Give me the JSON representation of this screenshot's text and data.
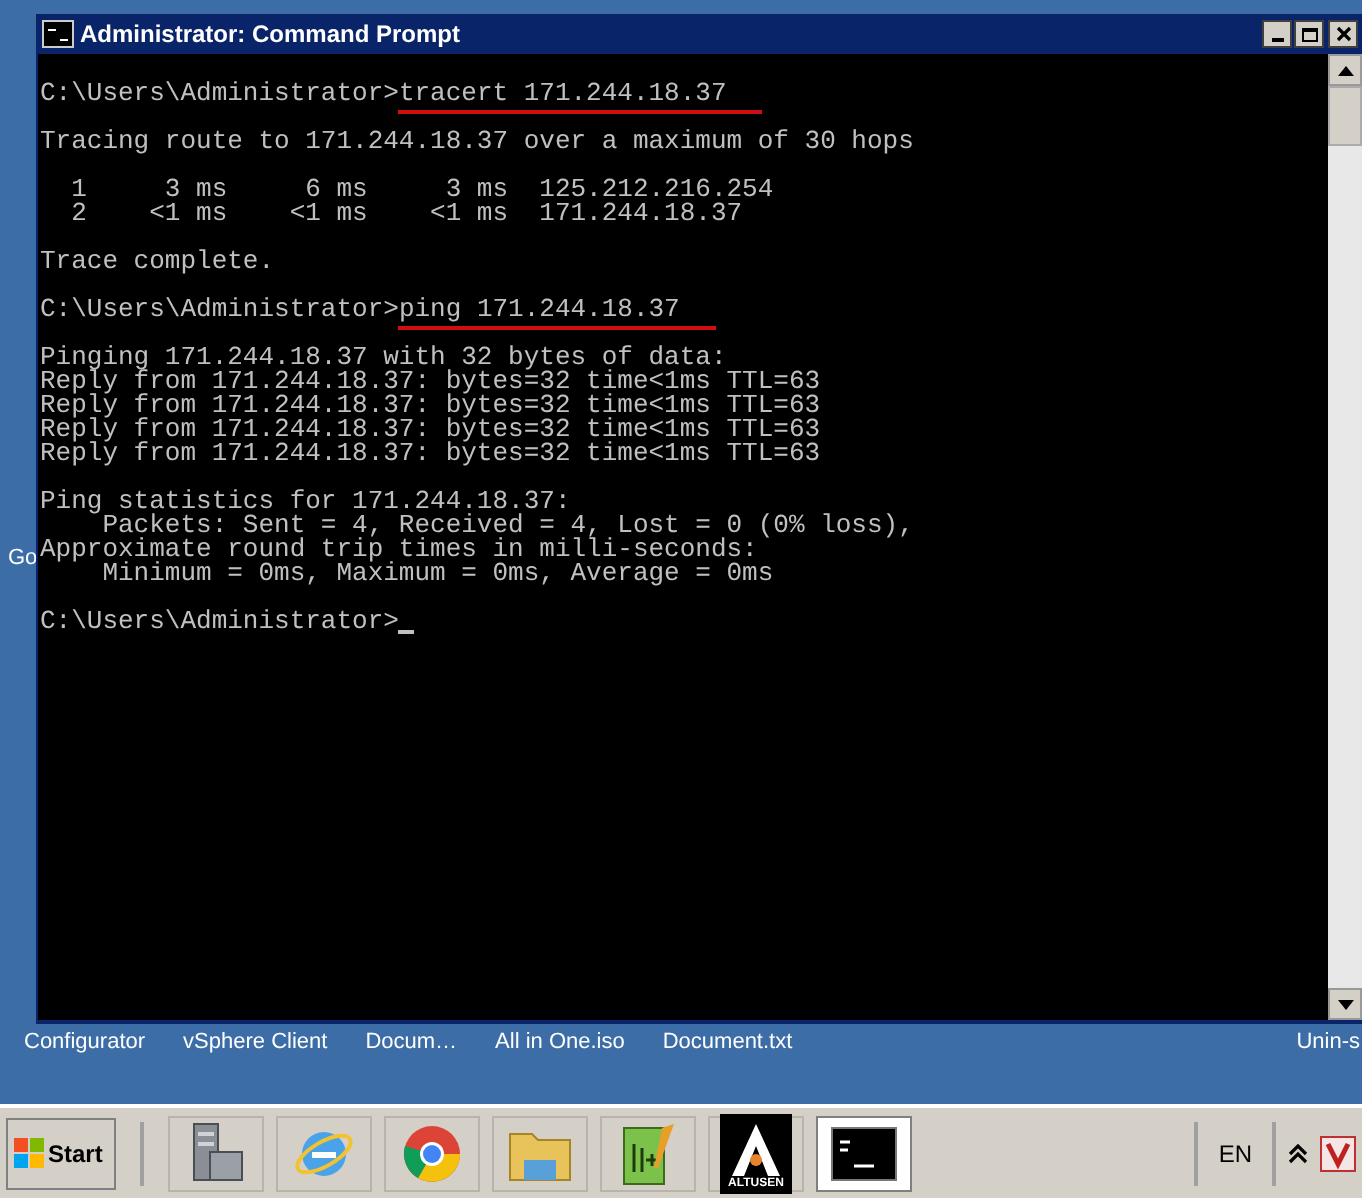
{
  "desktop": {
    "side_label": "Go",
    "icons": [
      "Configurator",
      "vSphere Client",
      "Docum…",
      "All in One.iso",
      "Document.txt",
      "Unin-s"
    ]
  },
  "window": {
    "title": "Administrator: Command Prompt"
  },
  "console": {
    "blocks": [
      [
        {
          "text": "C:\\Users\\Administrator>",
          "command": "tracert 171.244.18.37",
          "underlined": true
        }
      ],
      [
        {
          "text": "Tracing route to 171.244.18.37 over a maximum of 30 hops"
        }
      ],
      [
        {
          "text": "  1     3 ms     6 ms     3 ms  125.212.216.254"
        },
        {
          "text": "  2    <1 ms    <1 ms    <1 ms  171.244.18.37"
        }
      ],
      [
        {
          "text": "Trace complete."
        }
      ],
      [
        {
          "text": "C:\\Users\\Administrator>",
          "command": "ping 171.244.18.37",
          "underlined": true
        }
      ],
      [
        {
          "text": "Pinging 171.244.18.37 with 32 bytes of data:"
        },
        {
          "text": "Reply from 171.244.18.37: bytes=32 time<1ms TTL=63"
        },
        {
          "text": "Reply from 171.244.18.37: bytes=32 time<1ms TTL=63"
        },
        {
          "text": "Reply from 171.244.18.37: bytes=32 time<1ms TTL=63"
        },
        {
          "text": "Reply from 171.244.18.37: bytes=32 time<1ms TTL=63"
        }
      ],
      [
        {
          "text": "Ping statistics for 171.244.18.37:"
        },
        {
          "text": "    Packets: Sent = 4, Received = 4, Lost = 0 (0% loss),"
        },
        {
          "text": "Approximate round trip times in milli-seconds:"
        },
        {
          "text": "    Minimum = 0ms, Maximum = 0ms, Average = 0ms"
        }
      ],
      [
        {
          "text": "C:\\Users\\Administrator>",
          "cursor": true
        }
      ]
    ]
  },
  "taskbar": {
    "start": "Start",
    "apps": [
      {
        "kind": "server",
        "active": false
      },
      {
        "kind": "ie",
        "active": false
      },
      {
        "kind": "chrome",
        "active": false
      },
      {
        "kind": "folder",
        "active": false
      },
      {
        "kind": "notepad",
        "active": false
      },
      {
        "kind": "altusen",
        "label": "ALTUSEN",
        "active": false
      },
      {
        "kind": "console",
        "active": true
      }
    ],
    "language": "EN"
  }
}
